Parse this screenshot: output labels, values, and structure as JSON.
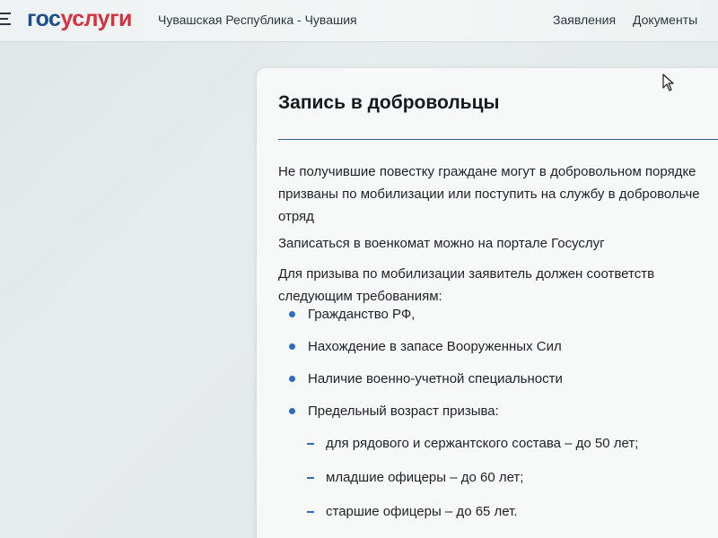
{
  "header": {
    "logo_part1": "гос",
    "logo_part2": "услуги",
    "region": "Чувашская Республика - Чувашия",
    "nav": {
      "applications": "Заявления",
      "documents": "Документы"
    }
  },
  "main": {
    "title": "Запись в добровольцы",
    "intro_lines": [
      "Не получившие повестку граждане могут в добровольном порядке",
      "призваны по мобилизации или поступить на службу в добровольче",
      "отряд"
    ],
    "portal_text": "Записаться в военкомат можно на портале Госуслуг",
    "requirements_lines": [
      "Для  призыва  по  мобилизации  заявитель  должен  соответств",
      "следующим требованиям:"
    ],
    "requirements": [
      "Гражданство РФ,",
      "Нахождение в запасе Вооруженных Сил",
      "Наличие военно-учетной специальности",
      "Предельный возраст призыва:"
    ],
    "age_limits": [
      "для рядового и сержантского состава – до 50 лет;",
      "младшие офицеры – до 60 лет;",
      "старшие офицеры – до 65 лет."
    ]
  },
  "colors": {
    "brand_blue": "#1f4e8f",
    "brand_red": "#d5313f",
    "accent": "#2e6bc6"
  }
}
